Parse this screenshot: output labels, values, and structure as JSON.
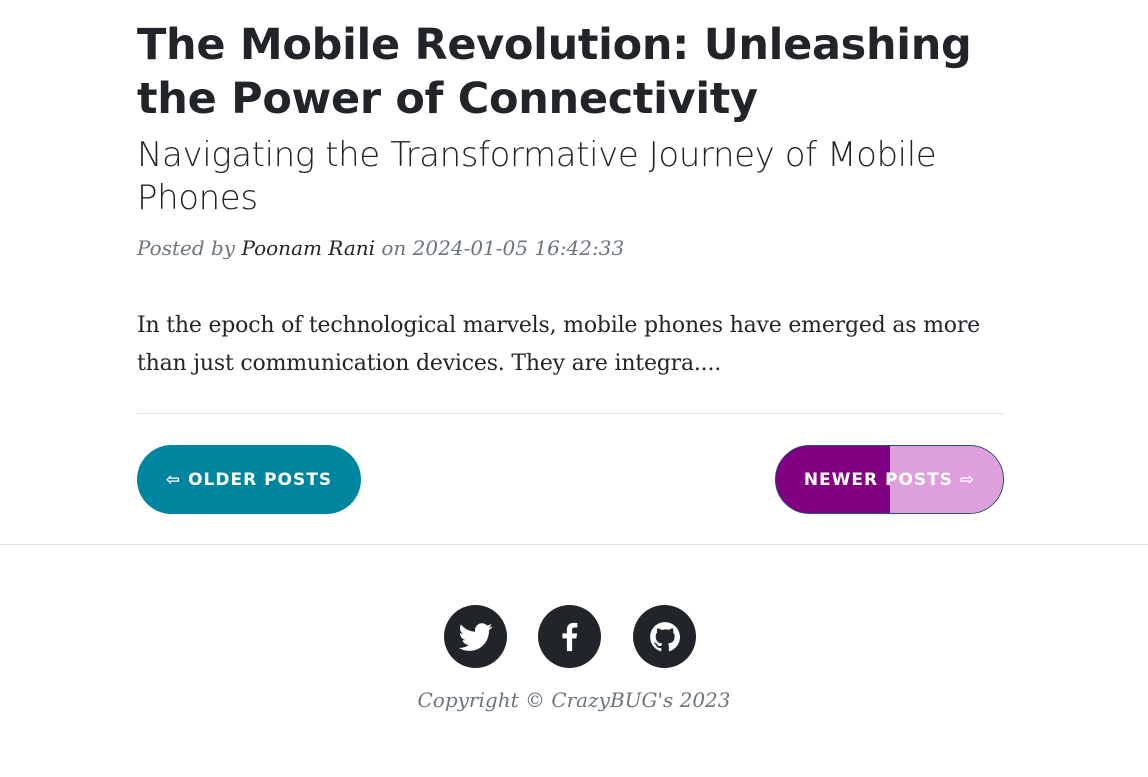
{
  "post": {
    "title": "The Mobile Revolution: Unleashing the Power of Connectivity",
    "subtitle": "Navigating the Transformative Journey of Mobile Phones",
    "meta_prefix": "Posted by",
    "author": "Poonam Rani",
    "meta_on": "on",
    "date": "2024-01-05 16:42:33",
    "excerpt": "In the epoch of technological marvels, mobile phones have emerged as more than just communication devices. They are integra...."
  },
  "pager": {
    "older_label": "⇦ OLDER POSTS",
    "newer_label": "NEWER POSTS ⇨"
  },
  "footer": {
    "social": [
      "twitter-icon",
      "facebook-icon",
      "github-icon"
    ],
    "copyright": "Copyright © CrazyBUG's 2023"
  },
  "colors": {
    "older_button": "#0085a1",
    "newer_button_left": "#800080",
    "newer_button_right": "#dda0dd",
    "social_bg": "#212529",
    "meta_text": "#6c757d"
  }
}
